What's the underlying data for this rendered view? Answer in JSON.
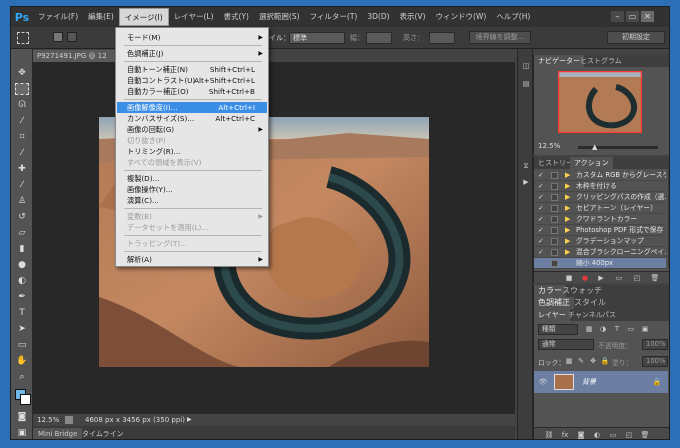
{
  "app": {
    "logo": "Ps"
  },
  "menubar": {
    "items": [
      "ファイル(F)",
      "編集(E)",
      "イメージ(I)",
      "レイヤー(L)",
      "書式(Y)",
      "選択範囲(S)",
      "フィルター(T)",
      "3D(D)",
      "表示(V)",
      "ウィンドウ(W)",
      "ヘルプ(H)"
    ],
    "active_index": 2
  },
  "window_controls": {
    "minimize": "–",
    "restore": "▭",
    "close": "✕"
  },
  "options_bar": {
    "style_label": "イル：",
    "style_value": "標準",
    "width_label": "幅：",
    "height_label": "高さ：",
    "refine_edge_button": "境界線を調整...",
    "workspace_button": "初期設定"
  },
  "document": {
    "tab_title": "P9271491.JPG @ 12",
    "zoom": "12.5%",
    "dimensions": "4608 px x 3456 px (350 ppi)"
  },
  "bottom_tabs": [
    "Mini Bridge",
    "タイムライン"
  ],
  "image_menu": {
    "items": [
      {
        "label": "モード(M)",
        "shortcut": "",
        "submenu": true
      },
      {
        "sep": true
      },
      {
        "label": "色調補正(J)",
        "shortcut": "",
        "submenu": true
      },
      {
        "sep": true
      },
      {
        "label": "自動トーン補正(N)",
        "shortcut": "Shift+Ctrl+L"
      },
      {
        "label": "自動コントラスト(U)",
        "shortcut": "Alt+Shift+Ctrl+L"
      },
      {
        "label": "自動カラー補正(O)",
        "shortcut": "Shift+Ctrl+B"
      },
      {
        "sep": true
      },
      {
        "label": "画像解像度(I)...",
        "shortcut": "Alt+Ctrl+I",
        "highlight": true
      },
      {
        "label": "カンバスサイズ(S)...",
        "shortcut": "Alt+Ctrl+C"
      },
      {
        "label": "画像の回転(G)",
        "shortcut": "",
        "submenu": true
      },
      {
        "label": "切り抜き(P)",
        "shortcut": "",
        "disabled": true
      },
      {
        "label": "トリミング(R)...",
        "shortcut": ""
      },
      {
        "label": "すべての領域を表示(V)",
        "shortcut": "",
        "disabled": true
      },
      {
        "sep": true
      },
      {
        "label": "複製(D)...",
        "shortcut": ""
      },
      {
        "label": "画像操作(Y)...",
        "shortcut": ""
      },
      {
        "label": "演算(C)...",
        "shortcut": ""
      },
      {
        "sep": true
      },
      {
        "label": "変数(B)",
        "shortcut": "",
        "disabled": true,
        "submenu": true
      },
      {
        "label": "データセットを適用(L)...",
        "shortcut": "",
        "disabled": true
      },
      {
        "sep": true
      },
      {
        "label": "トラッピング(T)...",
        "shortcut": "",
        "disabled": true
      },
      {
        "sep": true
      },
      {
        "label": "解析(A)",
        "shortcut": "",
        "submenu": true
      }
    ]
  },
  "navigator_panel": {
    "tabs": [
      "ナビゲーター",
      "ヒストグラム"
    ],
    "zoom": "12.5%"
  },
  "history_panel": {
    "tabs": [
      "ヒストリー",
      "アクション"
    ],
    "rows": [
      {
        "label": "カスタム RGB からグレースケ..."
      },
      {
        "label": "木枠を付ける"
      },
      {
        "label": "クリッピングパスの作成（選..."
      },
      {
        "label": "セピアトーン（レイヤー）"
      },
      {
        "label": "クワドラントカラー"
      },
      {
        "label": "Photoshop PDF 形式で保存"
      },
      {
        "label": "グラデーションマップ"
      },
      {
        "label": "混合ブラシクローニングペイ..."
      },
      {
        "label": "縮小 400px",
        "selected": true
      }
    ]
  },
  "color_panel": {
    "tabs": [
      "カラー",
      "スウォッチ"
    ],
    "tabs2": [
      "色調補正",
      "スタイル"
    ]
  },
  "layers_panel": {
    "tabs": [
      "レイヤー",
      "チャンネル",
      "パス"
    ],
    "filter_kind": "種類",
    "blend_mode": "通常",
    "opacity_label": "不透明度：",
    "opacity_value": "100%",
    "lock_label": "ロック：",
    "fill_label": "塗り：",
    "fill_value": "100%",
    "layer_name": "背景"
  }
}
